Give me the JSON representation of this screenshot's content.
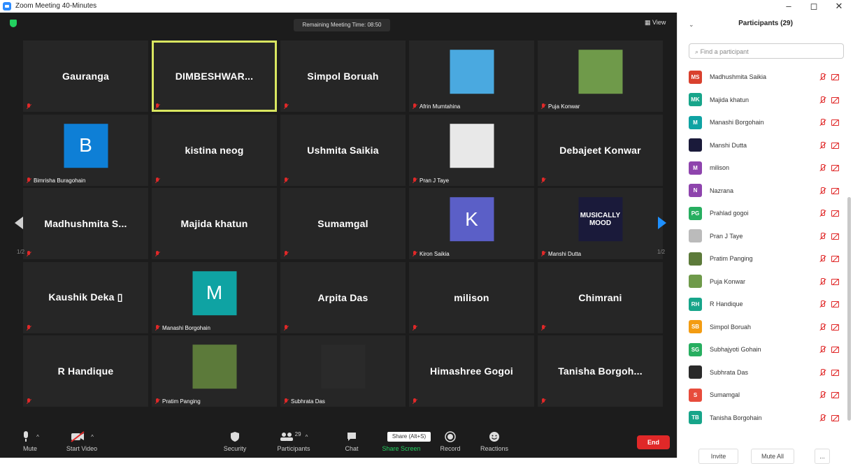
{
  "window": {
    "title": "Zoom Meeting 40-Minutes",
    "minimize": "–",
    "maximize": "◻",
    "close": "✕"
  },
  "meeting": {
    "timer": "Remaining Meeting Time: 08:50",
    "view_label": "View",
    "page_left": "1/2",
    "page_right": "1/2"
  },
  "tiles": [
    {
      "name": "Gauranga",
      "label": "",
      "thumb": null
    },
    {
      "name": "DIMBESHWAR...",
      "label": "",
      "thumb": null,
      "active": true
    },
    {
      "name": "Simpol Boruah",
      "label": "",
      "thumb": null
    },
    {
      "name": "",
      "label": "Afrin Mumtahina",
      "thumb": {
        "kind": "image",
        "icon": "cartoon-cat-avatar",
        "color": "#4aa9e0"
      }
    },
    {
      "name": "",
      "label": "Puja Konwar",
      "thumb": {
        "kind": "image",
        "icon": "landscape-photo",
        "color": "#6f9a4a"
      }
    },
    {
      "name": "",
      "label": "Bimrisha Buragohain",
      "thumb": {
        "kind": "letter",
        "letter": "B",
        "color": "#0e7fd6"
      }
    },
    {
      "name": "kistina neog",
      "label": "",
      "thumb": null
    },
    {
      "name": "Ushmita Saikia",
      "label": "",
      "thumb": null
    },
    {
      "name": "",
      "label": "Pran J Taye",
      "thumb": {
        "kind": "image",
        "icon": "anime-avatar",
        "color": "#e8e8e8"
      }
    },
    {
      "name": "Debajeet Konwar",
      "label": "",
      "thumb": null
    },
    {
      "name": "Madhushmita S...",
      "label": "",
      "thumb": null
    },
    {
      "name": "Majida khatun",
      "label": "",
      "thumb": null
    },
    {
      "name": "Sumamgal",
      "label": "",
      "thumb": null
    },
    {
      "name": "",
      "label": "Kiron Saikia",
      "thumb": {
        "kind": "letter",
        "letter": "K",
        "color": "#5b5fc7"
      }
    },
    {
      "name": "",
      "label": "Manshi Dutta",
      "thumb": {
        "kind": "text",
        "text": "MUSICALLY MOOD",
        "color": "#1a1a3a"
      }
    },
    {
      "name": "Kaushik Deka ▯",
      "label": "",
      "thumb": null
    },
    {
      "name": "",
      "label": "Manashi Borgohain",
      "thumb": {
        "kind": "letter",
        "letter": "M",
        "color": "#0fa3a3"
      }
    },
    {
      "name": "Arpita Das",
      "label": "",
      "thumb": null
    },
    {
      "name": "milison",
      "label": "",
      "thumb": null
    },
    {
      "name": "Chimrani",
      "label": "",
      "thumb": null
    },
    {
      "name": "R Handique",
      "label": "",
      "thumb": null
    },
    {
      "name": "",
      "label": "Pratim Panging",
      "thumb": {
        "kind": "image",
        "icon": "person-photo",
        "color": "#5c7a3a"
      }
    },
    {
      "name": "",
      "label": "Subhrata Das",
      "thumb": {
        "kind": "image",
        "icon": "anime-avatar",
        "color": "#2a2a2a"
      }
    },
    {
      "name": "Himashree Gogoi",
      "label": "",
      "thumb": null
    },
    {
      "name": "Tanisha Borgoh...",
      "label": "",
      "thumb": null
    }
  ],
  "toolbar": {
    "mute": "Mute",
    "start_video": "Start Video",
    "security": "Security",
    "participants": "Participants",
    "participants_count": "29",
    "chat": "Chat",
    "share_screen": "Share Screen",
    "share_tip": "Share (Alt+S)",
    "record": "Record",
    "reactions": "Reactions",
    "end": "End"
  },
  "panel": {
    "title": "Participants (29)",
    "search_placeholder": "Find a participant",
    "invite": "Invite",
    "mute_all": "Mute All",
    "more": "..."
  },
  "participants": [
    {
      "initials": "MS",
      "name": "Madhushmita Saikia",
      "color": "#d9412e"
    },
    {
      "initials": "MK",
      "name": "Majida khatun",
      "color": "#17a58a"
    },
    {
      "initials": "M",
      "name": "Manashi Borgohain",
      "color": "#0fa3a3"
    },
    {
      "initials": "",
      "name": "Manshi Dutta",
      "color": "#1a1a3a"
    },
    {
      "initials": "M",
      "name": "milison",
      "color": "#8e44ad"
    },
    {
      "initials": "N",
      "name": "Nazrana",
      "color": "#8e44ad"
    },
    {
      "initials": "PG",
      "name": "Prahlad gogoi",
      "color": "#27ae60"
    },
    {
      "initials": "",
      "name": "Pran J Taye",
      "color": "#bbbbbb"
    },
    {
      "initials": "",
      "name": "Pratim Panging",
      "color": "#5c7a3a"
    },
    {
      "initials": "",
      "name": "Puja Konwar",
      "color": "#6f9a4a"
    },
    {
      "initials": "RH",
      "name": "R Handique",
      "color": "#17a58a"
    },
    {
      "initials": "SB",
      "name": "Simpol Boruah",
      "color": "#f39c12"
    },
    {
      "initials": "SG",
      "name": "Subhajyoti Gohain",
      "color": "#27ae60"
    },
    {
      "initials": "",
      "name": "Subhrata Das",
      "color": "#2a2a2a"
    },
    {
      "initials": "S",
      "name": "Sumamgal",
      "color": "#e74c3c"
    },
    {
      "initials": "TB",
      "name": "Tanisha Borgohain",
      "color": "#17a58a"
    }
  ]
}
